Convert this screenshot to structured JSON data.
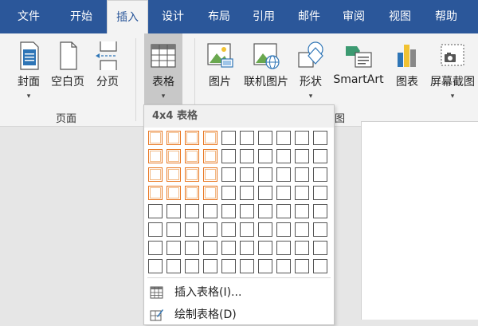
{
  "menu": {
    "tabs": [
      {
        "label": "文件"
      },
      {
        "label": "开始"
      },
      {
        "label": "插入",
        "active": true
      },
      {
        "label": "设计"
      },
      {
        "label": "布局"
      },
      {
        "label": "引用"
      },
      {
        "label": "邮件"
      },
      {
        "label": "审阅"
      },
      {
        "label": "视图"
      },
      {
        "label": "帮助"
      }
    ]
  },
  "ribbon": {
    "buttons": [
      {
        "label": "封面",
        "has_dropdown": true,
        "icon": "cover-page-icon"
      },
      {
        "label": "空白页",
        "icon": "blank-page-icon"
      },
      {
        "label": "分页",
        "icon": "page-break-icon"
      },
      {
        "label": "表格",
        "has_dropdown": true,
        "icon": "table-icon",
        "pressed": true
      },
      {
        "label": "图片",
        "icon": "picture-icon"
      },
      {
        "label": "联机图片",
        "icon": "online-picture-icon"
      },
      {
        "label": "形状",
        "has_dropdown": true,
        "icon": "shapes-icon"
      },
      {
        "label": "SmartArt",
        "icon": "smartart-icon"
      },
      {
        "label": "图表",
        "icon": "chart-icon"
      },
      {
        "label": "屏幕截图",
        "has_dropdown": true,
        "icon": "screenshot-icon"
      }
    ],
    "groups": [
      {
        "label": "页面"
      },
      {
        "label": "图"
      }
    ]
  },
  "table_dropdown": {
    "header": "4x4 表格",
    "grid": {
      "rows": 8,
      "cols": 10,
      "selected_rows": 4,
      "selected_cols": 4
    },
    "items": [
      {
        "label": "插入表格(I)...",
        "icon": "insert-table-icon"
      },
      {
        "label": "绘制表格(D)",
        "icon": "draw-table-icon"
      }
    ]
  },
  "colors": {
    "brand": "#2b579a",
    "selection": "#e87722"
  }
}
